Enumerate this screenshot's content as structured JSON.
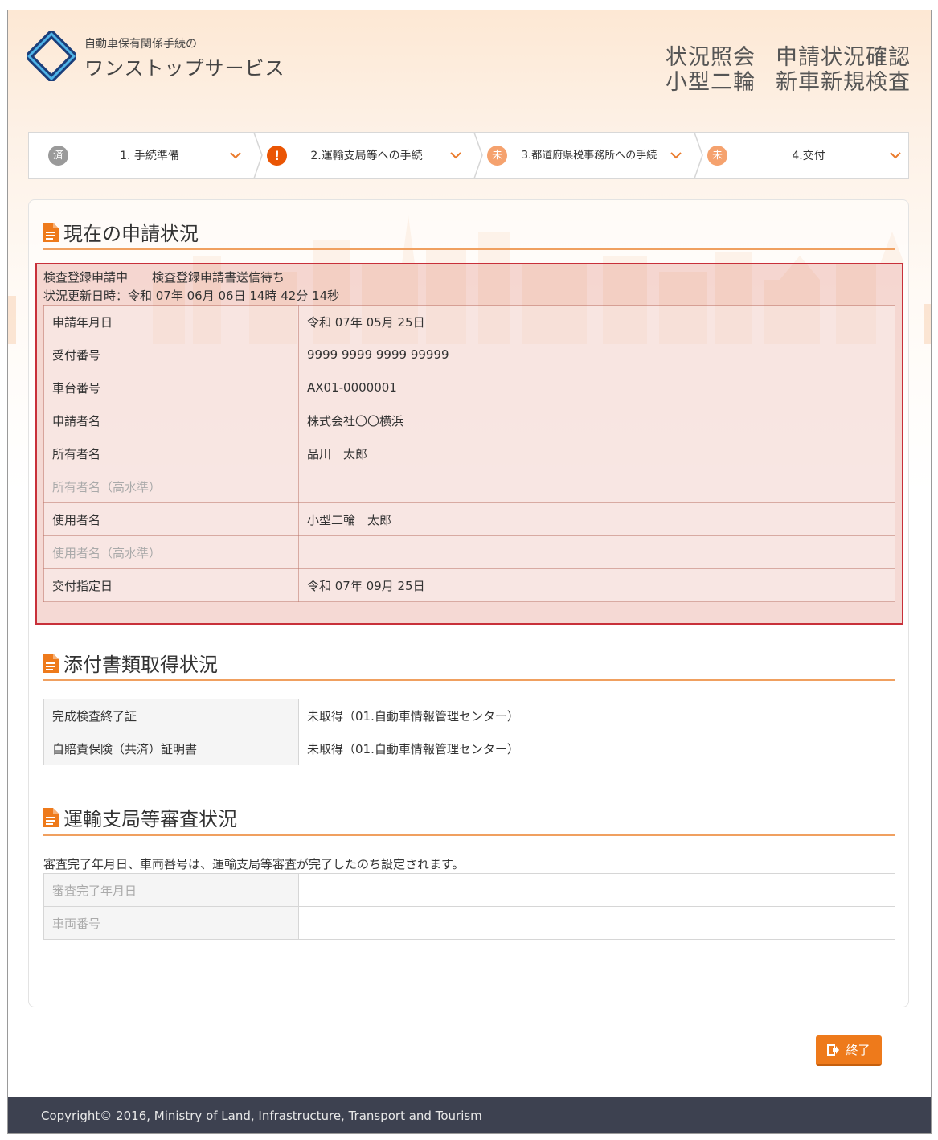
{
  "header": {
    "logo_sub": "自動車保有関係手続の",
    "logo_main": "ワンストップサービス",
    "title_1": "状況照会",
    "title_2": "申請状況確認",
    "title_3": "小型二輪",
    "title_4": "新車新規検査"
  },
  "steps": [
    {
      "badge": "済",
      "label": "1. 手続準備",
      "status": "done"
    },
    {
      "badge": "!",
      "label": "2.運輸支局等への手続",
      "status": "warn"
    },
    {
      "badge": "未",
      "label": "3.都道府県税事務所への手続",
      "status": "todo"
    },
    {
      "badge": "未",
      "label": "4.交付",
      "status": "todo"
    }
  ],
  "current": {
    "title": "現在の申請状況",
    "status_line": "検査登録申請中　　検査登録申請書送信待ち",
    "updated_line": "状況更新日時：令和 07年 06月 06日 14時 42分 14秒",
    "rows": [
      {
        "key": "申請年月日",
        "value": "令和 07年 05月 25日"
      },
      {
        "key": "受付番号",
        "value": "9999 9999 9999 99999"
      },
      {
        "key": "車台番号",
        "value": "AX01-0000001"
      },
      {
        "key": "申請者名",
        "value": "株式会社〇〇横浜"
      },
      {
        "key": "所有者名",
        "value": "品川　太郎"
      },
      {
        "key": "所有者名（高水準）",
        "value": ""
      },
      {
        "key": "使用者名",
        "value": "小型二輪　太郎"
      },
      {
        "key": "使用者名（高水準）",
        "value": ""
      },
      {
        "key": "交付指定日",
        "value": "令和 07年 09月 25日"
      }
    ]
  },
  "attachments": {
    "title": "添付書類取得状況",
    "rows": [
      {
        "key": "完成検査終了証",
        "value": "未取得（01.自動車情報管理センター）"
      },
      {
        "key": "自賠責保険（共済）証明書",
        "value": "未取得（01.自動車情報管理センター）"
      }
    ]
  },
  "review": {
    "title": "運輸支局等審査状況",
    "note": "審査完了年月日、車両番号は、運輸支局等審査が完了したのち設定されます。",
    "rows": [
      {
        "key": "審査完了年月日",
        "value": ""
      },
      {
        "key": "車両番号",
        "value": ""
      }
    ]
  },
  "exit_label": "終了",
  "footer": "Copyright© 2016, Ministry of Land, Infrastructure, Transport and Tourism",
  "colors": {
    "accent": "#ee7a1b",
    "highlight": "#c8303a",
    "footer_bg": "#3d4150"
  }
}
